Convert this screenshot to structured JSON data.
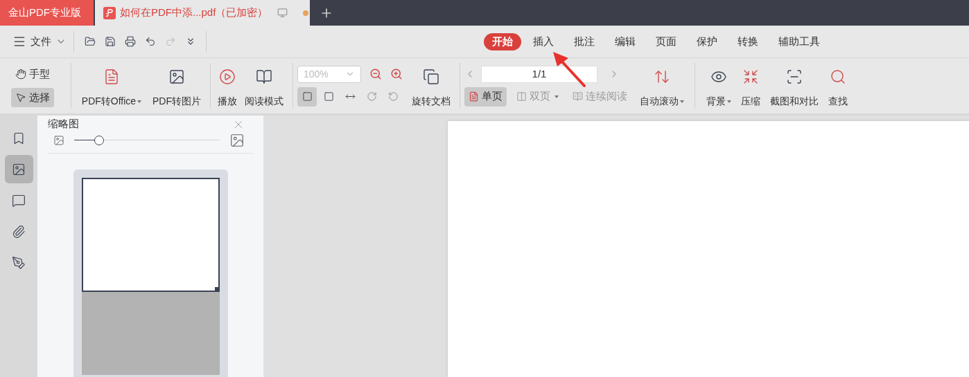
{
  "app_tab": {
    "label": "金山PDF专业版"
  },
  "doc_tab": {
    "label": "如何在PDF中添...pdf（已加密）",
    "unsaved": true
  },
  "file_menu": {
    "label": "文件"
  },
  "quick_tools": [
    {
      "disabled": false
    },
    {
      "disabled": false
    },
    {
      "disabled": false
    },
    {
      "disabled": false
    },
    {
      "disabled": true
    },
    {
      "disabled": false
    }
  ],
  "ribbon_tabs": [
    {
      "label": "开始",
      "selected": true
    },
    {
      "label": "插入",
      "selected": false
    },
    {
      "label": "批注",
      "selected": false
    },
    {
      "label": "编辑",
      "selected": false
    },
    {
      "label": "页面",
      "selected": false
    },
    {
      "label": "保护",
      "selected": false
    },
    {
      "label": "转换",
      "selected": false
    },
    {
      "label": "辅助工具",
      "selected": false
    }
  ],
  "cursor_tools": [
    {
      "label": "手型",
      "selected": false
    },
    {
      "label": "选择",
      "selected": true
    }
  ],
  "convert_tools": [
    {
      "label": "PDF转Office",
      "dropdown": true
    },
    {
      "label": "PDF转图片",
      "dropdown": false
    }
  ],
  "view_tools": [
    {
      "label": "播放"
    },
    {
      "label": "阅读模式"
    }
  ],
  "zoom": {
    "value": "100%",
    "disabled": true
  },
  "fit_tools": [
    {
      "selected": true
    },
    {
      "selected": false
    },
    {
      "selected": false
    },
    {
      "selected": false
    },
    {
      "selected": false
    }
  ],
  "rotate": {
    "label": "旋转文档"
  },
  "page_field": {
    "value": "1/1"
  },
  "layout_modes": [
    {
      "label": "单页",
      "selected": true,
      "disabled": false,
      "dropdown": false
    },
    {
      "label": "双页",
      "selected": false,
      "disabled": true,
      "dropdown": true
    },
    {
      "label": "连续阅读",
      "selected": false,
      "disabled": true,
      "dropdown": false
    }
  ],
  "auto_scroll": {
    "label": "自动滚动",
    "dropdown": true
  },
  "extra_tools": [
    {
      "label": "背景",
      "dropdown": true
    },
    {
      "label": "压缩",
      "dropdown": false
    },
    {
      "label": "截图和对比",
      "dropdown": false
    },
    {
      "label": "查找",
      "dropdown": false
    }
  ],
  "side_rail": [
    {
      "selected": false
    },
    {
      "selected": true
    },
    {
      "selected": false
    },
    {
      "selected": false
    },
    {
      "selected": false
    }
  ],
  "thumbnail_panel": {
    "title": "缩略图",
    "size": {
      "level": 0.17
    },
    "pages": [
      {
        "selected": true
      }
    ]
  }
}
